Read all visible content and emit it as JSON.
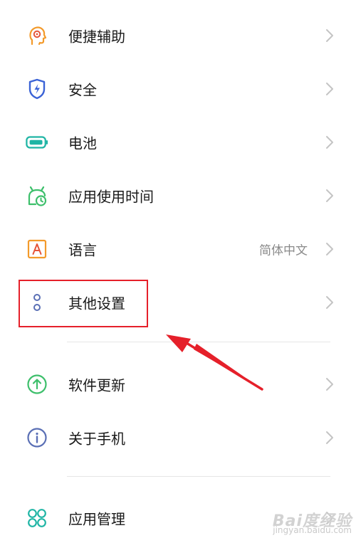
{
  "settings": {
    "items": [
      {
        "label": "便捷辅助",
        "icon": "accessibility-head-icon",
        "value": ""
      },
      {
        "label": "安全",
        "icon": "shield-lightning-icon",
        "value": ""
      },
      {
        "label": "电池",
        "icon": "battery-icon",
        "value": ""
      },
      {
        "label": "应用使用时间",
        "icon": "app-usage-clock-icon",
        "value": ""
      },
      {
        "label": "语言",
        "icon": "language-a-icon",
        "value": "简体中文"
      },
      {
        "label": "其他设置",
        "icon": "more-dots-icon",
        "value": ""
      },
      {
        "label": "软件更新",
        "icon": "update-arrow-icon",
        "value": ""
      },
      {
        "label": "关于手机",
        "icon": "info-icon",
        "value": ""
      },
      {
        "label": "应用管理",
        "icon": "app-grid-icon",
        "value": ""
      }
    ]
  },
  "annotation": {
    "highlight_color": "#e5202a",
    "target": "其他设置"
  },
  "watermark": {
    "logo": "Bai度经验",
    "url": "jingyan.baidu.com"
  },
  "colors": {
    "orange": "#f39a2b",
    "blue": "#3b63d6",
    "teal": "#1fb5a5",
    "green": "#3dbf6b",
    "slate": "#5a6fb5",
    "chevron": "#c4c4c4"
  }
}
